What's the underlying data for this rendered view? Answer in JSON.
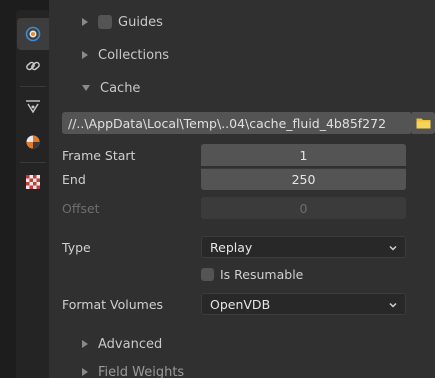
{
  "tabs": [
    {
      "name": "physics-target-icon",
      "active": true
    },
    {
      "name": "constraint-link-icon",
      "active": false
    },
    {
      "name": "modifier-vertex-icon",
      "active": false
    },
    {
      "name": "material-shading-icon",
      "active": false
    },
    {
      "name": "texture-checker-icon",
      "active": false
    }
  ],
  "sections": {
    "guides": {
      "label": "Guides"
    },
    "collections": {
      "label": "Collections"
    },
    "cache": {
      "label": "Cache"
    },
    "advanced": {
      "label": "Advanced"
    },
    "field_weights": {
      "label": "Field Weights"
    }
  },
  "cache": {
    "directory": "//..\\AppData\\Local\\Temp\\..04\\cache_fluid_4b85f272",
    "frame_start_label": "Frame Start",
    "frame_start_value": "1",
    "end_label": "End",
    "end_value": "250",
    "offset_label": "Offset",
    "offset_value": "0",
    "type_label": "Type",
    "type_value": "Replay",
    "is_resumable_label": "Is Resumable",
    "format_volumes_label": "Format Volumes",
    "format_volumes_value": "OpenVDB"
  },
  "colors": {
    "panel_bg": "#303030",
    "field_bg": "#545454",
    "dropdown_bg": "#282828",
    "folder_icon": "#f2c12e"
  }
}
